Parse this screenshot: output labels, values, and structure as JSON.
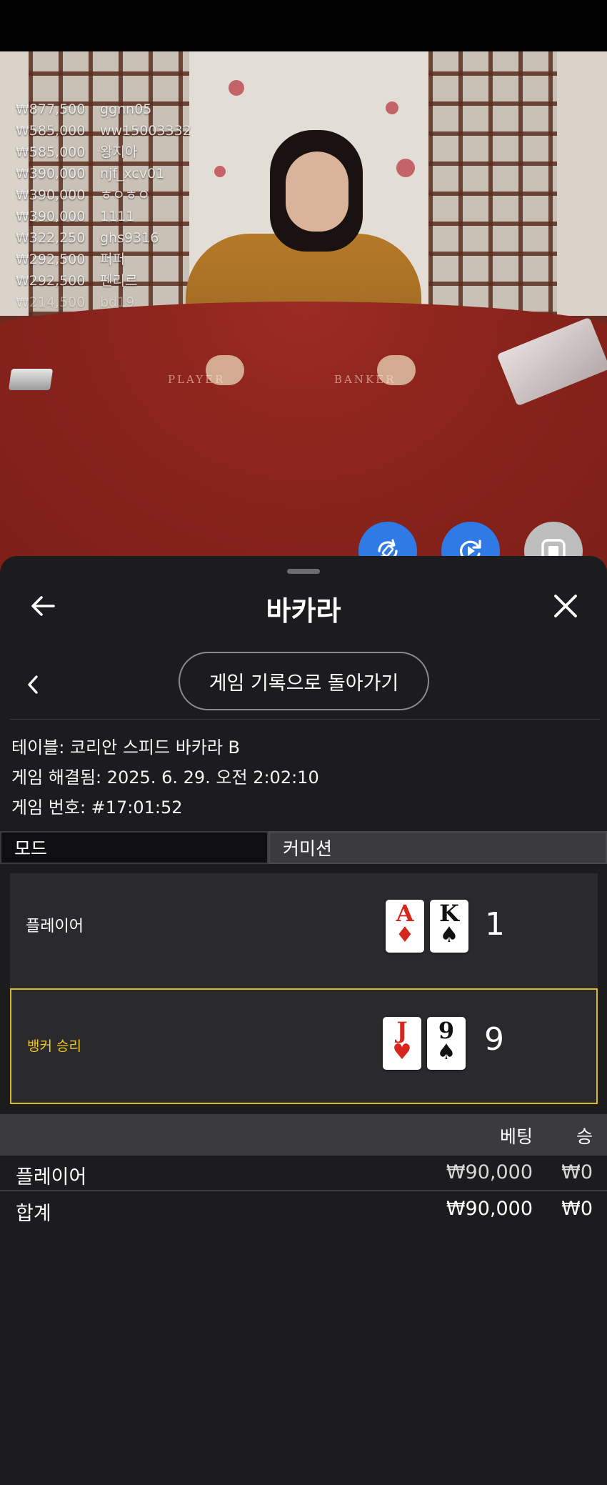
{
  "leaderboard": [
    {
      "amount": "₩877,500",
      "user": "ggnn05"
    },
    {
      "amount": "₩585,000",
      "user": "ww15003332"
    },
    {
      "amount": "₩585,000",
      "user": "왕지아"
    },
    {
      "amount": "₩390,000",
      "user": "njf_xcv01"
    },
    {
      "amount": "₩390,000",
      "user": "ㅎㅇㅎㅇ"
    },
    {
      "amount": "₩390,000",
      "user": "1111"
    },
    {
      "amount": "₩322,250",
      "user": "ghs9316"
    },
    {
      "amount": "₩292,500",
      "user": "퍼퍼"
    },
    {
      "amount": "₩292,500",
      "user": "펜리르"
    },
    {
      "amount": "₩214,500",
      "user": "bd19"
    }
  ],
  "felt": {
    "player_text": "PLAYER",
    "banker_text": "BANKER"
  },
  "fabs": [
    {
      "name": "rotate-icon",
      "color": "#2f7ae5"
    },
    {
      "name": "replay-icon",
      "color": "#2f7ae5"
    },
    {
      "name": "stop-icon",
      "color": "#bdbdbd"
    }
  ],
  "sheet": {
    "title": "바카라",
    "history_button": "게임 기록으로 돌아가기",
    "table_line": "테이블: 코리안 스피드 바카라 B",
    "resolved_line": "게임 해결됨: 2025. 6. 29. 오전 2:02:10",
    "game_number_line": "게임 번호: #17:01:52",
    "tabs": {
      "mode": "모드",
      "commission": "커미션"
    },
    "hands": {
      "player": {
        "label": "플레이어",
        "score": "1",
        "cards": [
          {
            "rank": "A",
            "suit": "♦",
            "color": "red"
          },
          {
            "rank": "K",
            "suit": "♠",
            "color": "black"
          }
        ]
      },
      "banker": {
        "label": "뱅커 승리",
        "score": "9",
        "cards": [
          {
            "rank": "J",
            "suit": "♥",
            "color": "red"
          },
          {
            "rank": "9",
            "suit": "♠",
            "color": "black"
          }
        ]
      }
    },
    "bets": {
      "header_bet": "베팅",
      "header_win": "승",
      "rows": [
        {
          "name": "플레이어",
          "bet": "₩90,000",
          "win": "₩0"
        }
      ],
      "total": {
        "name": "합계",
        "bet": "₩90,000",
        "win": "₩0"
      }
    }
  },
  "colors": {
    "accent_blue": "#2f7ae5",
    "win_gold": "#f0c928",
    "sheet_bg": "#1c1b1d"
  }
}
